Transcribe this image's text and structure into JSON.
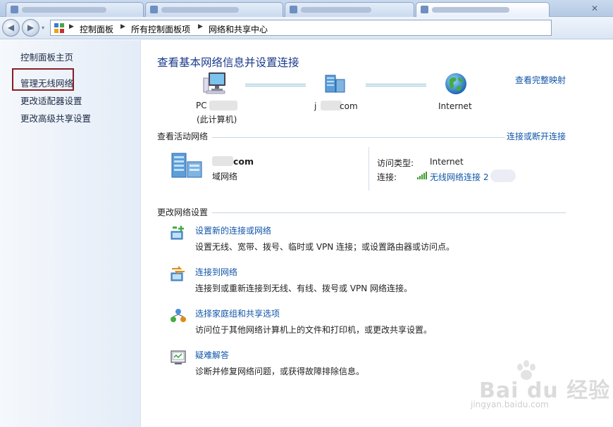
{
  "window": {
    "tabs": [
      {
        "state": "inactive"
      },
      {
        "state": "inactive"
      },
      {
        "state": "inactive"
      },
      {
        "state": "inactive"
      },
      {
        "state": "active"
      }
    ],
    "close_glyph": "✕"
  },
  "navigation": {
    "back_glyph": "◀",
    "forward_glyph": "▶",
    "recent_glyph": "▾",
    "address_icon": "control-panel-icon",
    "breadcrumbs": [
      "控制面板",
      "所有控制面板项",
      "网络和共享中心"
    ]
  },
  "sidebar": {
    "items": [
      {
        "label": "控制面板主页"
      },
      {
        "label": "管理无线网络",
        "highlighted": true
      },
      {
        "label": "更改适配器设置"
      },
      {
        "label": "更改高级共享设置"
      }
    ],
    "highlight_color": "#8a1c24"
  },
  "main": {
    "title": "查看基本网络信息并设置连接",
    "map_link": "查看完整映射",
    "map": {
      "computer": {
        "label_line1": "PC",
        "label_line2": "(此计算机)",
        "icon": "computer-icon"
      },
      "network": {
        "label": "j",
        "label_suffix": "com",
        "icon": "domain-network-icon"
      },
      "internet": {
        "label": "Internet",
        "icon": "globe-icon"
      }
    },
    "active_networks": {
      "heading": "查看活动网络",
      "connect_link": "连接或断开连接",
      "network_name": "com",
      "network_type": "域网络",
      "access_type_label": "访问类型:",
      "access_type_value": "Internet",
      "connection_label": "连接:",
      "connection_value": "无线网络连接 2",
      "signal_icon": "wifi-signal-icon"
    },
    "change_settings": {
      "heading": "更改网络设置",
      "tasks": [
        {
          "icon": "new-connection-icon",
          "title": "设置新的连接或网络",
          "desc": "设置无线、宽带、拨号、临时或 VPN 连接；或设置路由器或访问点。"
        },
        {
          "icon": "connect-network-icon",
          "title": "连接到网络",
          "desc": "连接到或重新连接到无线、有线、拨号或 VPN 网络连接。"
        },
        {
          "icon": "homegroup-icon",
          "title": "选择家庭组和共享选项",
          "desc": "访问位于其他网络计算机上的文件和打印机，或更改共享设置。"
        },
        {
          "icon": "troubleshoot-icon",
          "title": "疑难解答",
          "desc": "诊断并修复网络问题，或获得故障排除信息。"
        }
      ]
    }
  },
  "watermark": {
    "brand": "Bai du 经验",
    "url": "jingyan.baidu.com"
  },
  "colors": {
    "link": "#0f55a8",
    "title": "#1a3a8a",
    "sidebar_text": "#1c2a44"
  }
}
